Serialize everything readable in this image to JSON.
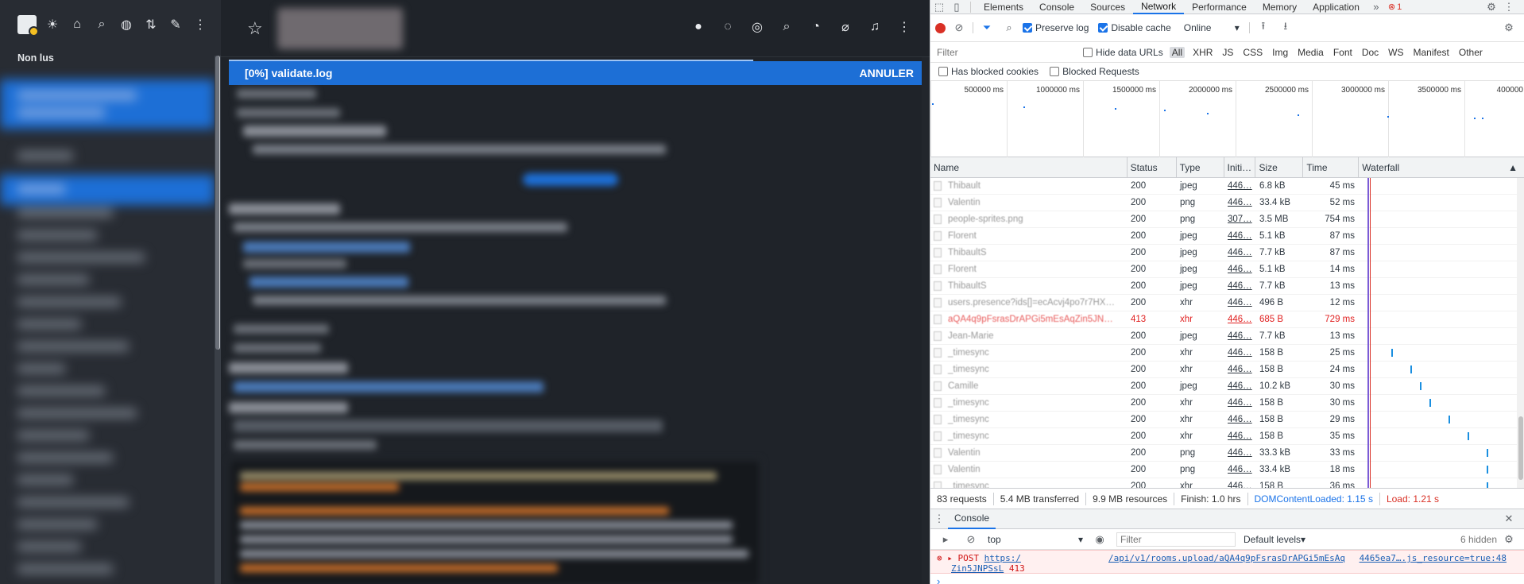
{
  "sidebar": {
    "unread_label": "Non lus",
    "icons": [
      "sun-icon",
      "home-icon",
      "search-icon",
      "globe-icon",
      "sort-icon",
      "edit-icon",
      "more-icon"
    ]
  },
  "room": {
    "header_icons": [
      "chat-icon",
      "discussion-icon",
      "threads-icon",
      "search-icon",
      "members-icon",
      "attachment-icon",
      "notifications-icon",
      "kebab-icon"
    ],
    "upload": {
      "label": "[0%] validate.log",
      "cancel": "ANNULER",
      "progress_percent": 0
    }
  },
  "devtools": {
    "tabs": [
      "Elements",
      "Console",
      "Sources",
      "Network",
      "Performance",
      "Memory",
      "Application"
    ],
    "active_tab": "Network",
    "error_count": "1",
    "toolbar": {
      "preserve_log": "Preserve log",
      "disable_cache": "Disable cache",
      "throttle": "Online"
    },
    "filter": {
      "placeholder": "Filter",
      "hide_data_urls": "Hide data URLs",
      "types": [
        "All",
        "XHR",
        "JS",
        "CSS",
        "Img",
        "Media",
        "Font",
        "Doc",
        "WS",
        "Manifest",
        "Other"
      ]
    },
    "blocked": {
      "has_blocked_cookies": "Has blocked cookies",
      "blocked_requests": "Blocked Requests"
    },
    "overview_ticks": [
      "500000 ms",
      "1000000 ms",
      "1500000 ms",
      "2000000 ms",
      "2500000 ms",
      "3000000 ms",
      "3500000 ms",
      "400000"
    ],
    "columns": {
      "name": "Name",
      "status": "Status",
      "type": "Type",
      "initiator": "Initi…",
      "size": "Size",
      "time": "Time",
      "waterfall": "Waterfall"
    },
    "requests": [
      {
        "name": "Thibault",
        "status": "200",
        "type": "jpeg",
        "initiator": "446…",
        "size": "6.8 kB",
        "time": "45 ms",
        "error": false
      },
      {
        "name": "Valentin",
        "status": "200",
        "type": "png",
        "initiator": "446…",
        "size": "33.4 kB",
        "time": "52 ms",
        "error": false
      },
      {
        "name": "people-sprites.png",
        "status": "200",
        "type": "png",
        "initiator": "307…",
        "size": "3.5 MB",
        "time": "754 ms",
        "error": false
      },
      {
        "name": "Florent",
        "status": "200",
        "type": "jpeg",
        "initiator": "446…",
        "size": "5.1 kB",
        "time": "87 ms",
        "error": false
      },
      {
        "name": "ThibaultS",
        "status": "200",
        "type": "jpeg",
        "initiator": "446…",
        "size": "7.7 kB",
        "time": "87 ms",
        "error": false
      },
      {
        "name": "Florent",
        "status": "200",
        "type": "jpeg",
        "initiator": "446…",
        "size": "5.1 kB",
        "time": "14 ms",
        "error": false
      },
      {
        "name": "ThibaultS",
        "status": "200",
        "type": "jpeg",
        "initiator": "446…",
        "size": "7.7 kB",
        "time": "13 ms",
        "error": false
      },
      {
        "name": "users.presence?ids[]=ecAcvj4po7r7HX…",
        "status": "200",
        "type": "xhr",
        "initiator": "446…",
        "size": "496 B",
        "time": "12 ms",
        "error": false
      },
      {
        "name": "aQA4q9pFsrasDrAPGi5mEsAqZin5JN…",
        "status": "413",
        "type": "xhr",
        "initiator": "446…",
        "size": "685 B",
        "time": "729 ms",
        "error": true
      },
      {
        "name": "Jean-Marie",
        "status": "200",
        "type": "jpeg",
        "initiator": "446…",
        "size": "7.7 kB",
        "time": "13 ms",
        "error": false
      },
      {
        "name": "_timesync",
        "status": "200",
        "type": "xhr",
        "initiator": "446…",
        "size": "158 B",
        "time": "25 ms",
        "error": false
      },
      {
        "name": "_timesync",
        "status": "200",
        "type": "xhr",
        "initiator": "446…",
        "size": "158 B",
        "time": "24 ms",
        "error": false
      },
      {
        "name": "Camille",
        "status": "200",
        "type": "jpeg",
        "initiator": "446…",
        "size": "10.2 kB",
        "time": "30 ms",
        "error": false
      },
      {
        "name": "_timesync",
        "status": "200",
        "type": "xhr",
        "initiator": "446…",
        "size": "158 B",
        "time": "30 ms",
        "error": false
      },
      {
        "name": "_timesync",
        "status": "200",
        "type": "xhr",
        "initiator": "446…",
        "size": "158 B",
        "time": "29 ms",
        "error": false
      },
      {
        "name": "_timesync",
        "status": "200",
        "type": "xhr",
        "initiator": "446…",
        "size": "158 B",
        "time": "35 ms",
        "error": false
      },
      {
        "name": "Valentin",
        "status": "200",
        "type": "png",
        "initiator": "446…",
        "size": "33.3 kB",
        "time": "33 ms",
        "error": false
      },
      {
        "name": "Valentin",
        "status": "200",
        "type": "png",
        "initiator": "446…",
        "size": "33.4 kB",
        "time": "18 ms",
        "error": false
      },
      {
        "name": "_timesync",
        "status": "200",
        "type": "xhr",
        "initiator": "446…",
        "size": "158 B",
        "time": "36 ms",
        "error": false
      }
    ],
    "summary": {
      "requests": "83 requests",
      "transferred": "5.4 MB transferred",
      "resources": "9.9 MB resources",
      "finish": "Finish: 1.0 hrs",
      "dcl": "DOMContentLoaded: 1.15 s",
      "load": "Load: 1.21 s"
    },
    "console": {
      "title": "Console",
      "context": "top",
      "filter_placeholder": "Filter",
      "levels": "Default levels",
      "hidden": "6 hidden",
      "error": {
        "method": "POST",
        "url_start": "https:/",
        "url_path": "/api/v1/rooms.upload/aQA4q9pFsrasDrAPGi5mEsAq",
        "url_end": "Zin5JNPSsL",
        "status": "413",
        "source": "4465ea7….js_resource=true:48"
      },
      "prompt": "›"
    }
  }
}
